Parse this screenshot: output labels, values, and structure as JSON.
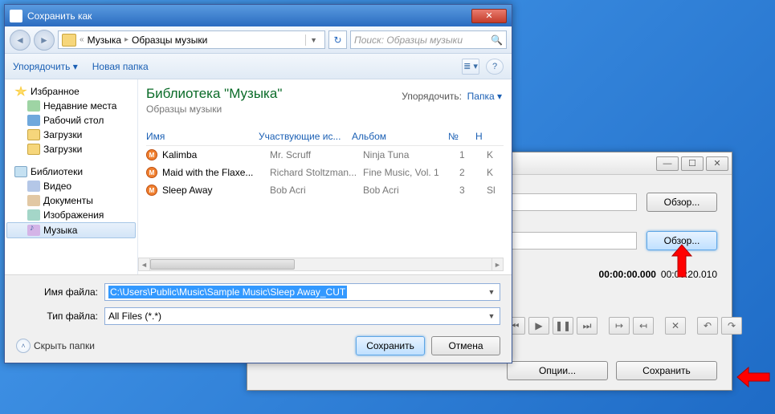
{
  "app": {
    "win_min": "—",
    "win_max": "☐",
    "win_close": "✕",
    "browse1": "Обзор...",
    "browse2": "Обзор...",
    "time_start": "00:00:00.000",
    "time_end": "00:00:20.010",
    "btn_options": "Опции...",
    "btn_save": "Сохранить",
    "icons": {
      "prev": "⏮",
      "play": "▶",
      "pause": "❚❚",
      "next": "⏭",
      "start": "↦",
      "end": "↤",
      "del": "✕",
      "undo": "↶",
      "redo": "↷"
    }
  },
  "save": {
    "title": "Сохранить как",
    "breadcrumb_sep": "«",
    "bc1": "Музыка",
    "bc2": "Образцы музыки",
    "search_placeholder": "Поиск: Образцы музыки",
    "organize": "Упорядочить ▾",
    "newfolder": "Новая папка",
    "view_ico": "≣ ▾",
    "help_ico": "?",
    "tree": {
      "fav": "Избранное",
      "recent": "Недавние места",
      "desktop": "Рабочий стол",
      "downloads": "Загрузки",
      "downloads2": "Загрузки",
      "libs": "Библиотеки",
      "video": "Видео",
      "docs": "Документы",
      "images": "Изображения",
      "music": "Музыка"
    },
    "lib_title": "Библиотека \"Музыка\"",
    "lib_sub": "Образцы музыки",
    "arrange_label": "Упорядочить:",
    "arrange_value": "Папка ▾",
    "cols": {
      "name": "Имя",
      "artist": "Участвующие ис...",
      "album": "Альбом",
      "no": "№",
      "h": "Н"
    },
    "rows": [
      {
        "name": "Kalimba",
        "artist": "Mr. Scruff",
        "album": "Ninja Tuna",
        "no": "1",
        "h": "K"
      },
      {
        "name": "Maid with the Flaxe...",
        "artist": "Richard Stoltzman...",
        "album": "Fine Music, Vol. 1",
        "no": "2",
        "h": "K"
      },
      {
        "name": "Sleep Away",
        "artist": "Bob Acri",
        "album": "Bob Acri",
        "no": "3",
        "h": "Sl"
      }
    ],
    "filename_label": "Имя файла:",
    "filename_value": "C:\\Users\\Public\\Music\\Sample Music\\Sleep Away_CUT",
    "filetype_label": "Тип файла:",
    "filetype_value": "All Files (*.*)",
    "hide_folders": "Скрыть папки",
    "btn_save": "Сохранить",
    "btn_cancel": "Отмена"
  }
}
